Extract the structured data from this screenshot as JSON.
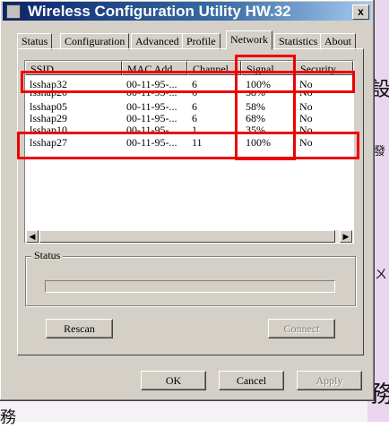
{
  "window": {
    "title": "Wireless Configuration Utility HW.32",
    "close_label": "x"
  },
  "tabs": [
    {
      "label": "Status",
      "active": false
    },
    {
      "label": "Configuration",
      "active": false
    },
    {
      "label": "Advanced",
      "active": false
    },
    {
      "label": "Profile",
      "active": false
    },
    {
      "label": "Network",
      "active": true
    },
    {
      "label": "Statistics",
      "active": false
    },
    {
      "label": "About",
      "active": false
    }
  ],
  "network_list": {
    "columns": [
      "SSID",
      "MAC Add...",
      "Channel",
      "Signal",
      "Security"
    ],
    "rows": [
      [
        "lsshap32",
        "00-11-95-...",
        "6",
        "100%",
        "No"
      ],
      [
        "lsshap20",
        "00-11-95-...",
        "6",
        "58%",
        "No"
      ],
      [
        "lsshap05",
        "00-11-95-...",
        "6",
        "58%",
        "No"
      ],
      [
        "lsshap29",
        "00-11-95-...",
        "6",
        "68%",
        "No"
      ],
      [
        "lsshap10",
        "00-11-95-...",
        "1",
        "35%",
        "No"
      ],
      [
        "lsshap27",
        "00-11-95-...",
        "11",
        "100%",
        "No"
      ]
    ]
  },
  "status_group": {
    "label": "Status"
  },
  "buttons": {
    "rescan": "Rescan",
    "connect": "Connect",
    "ok": "OK",
    "cancel": "Cancel",
    "apply": "Apply"
  },
  "background_glyphs": {
    "right_top": "設",
    "right_mid": "發",
    "right_bottom": "務",
    "left_bottom": "務",
    "right_small": "ㄨ"
  },
  "colors": {
    "titlebar_start": "#0a246a",
    "titlebar_end": "#a6caf0",
    "face": "#d4d0c8",
    "annotation_red": "#ee0000"
  }
}
